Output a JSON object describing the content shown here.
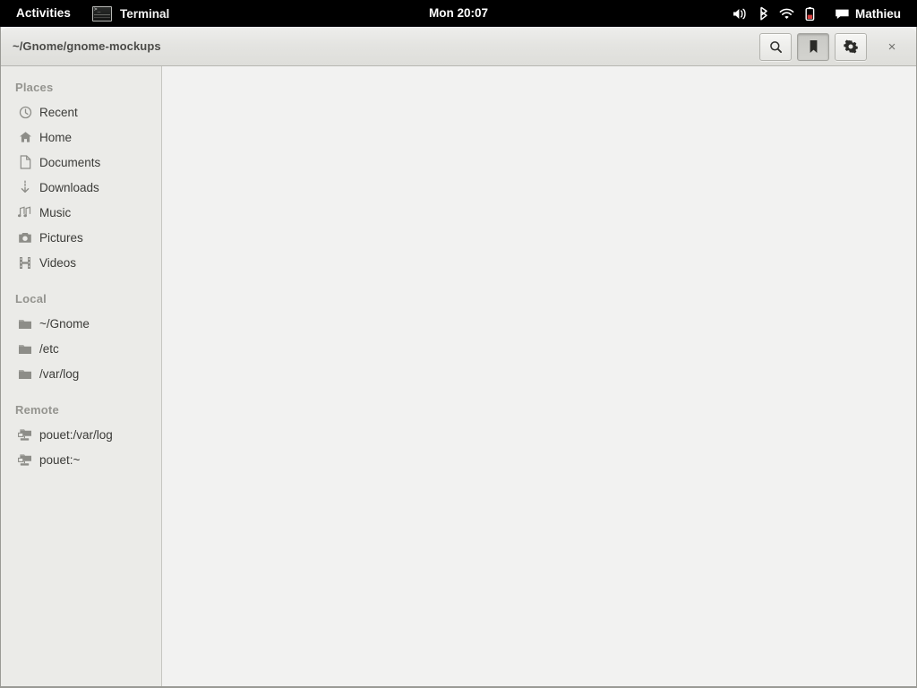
{
  "topbar": {
    "activities_label": "Activities",
    "app": {
      "name": "Terminal",
      "icon": "terminal-icon"
    },
    "clock": "Mon 20:07",
    "tray_icons": [
      "volume-icon",
      "bluetooth-icon",
      "wifi-icon",
      "battery-icon"
    ],
    "user": {
      "name": "Mathieu",
      "icon": "chat-bubble-icon"
    },
    "bg_color": "#000000",
    "fg_color": "#ffffff"
  },
  "window": {
    "title": "~/Gnome/gnome-mockups",
    "header_buttons": [
      {
        "name": "search-button",
        "icon": "search-icon",
        "label": "",
        "active": false
      },
      {
        "name": "bookmarks-button",
        "icon": "bookmark-icon",
        "label": "",
        "active": true
      },
      {
        "name": "settings-button",
        "icon": "gear-icon",
        "label": "",
        "active": false
      }
    ],
    "close_label": "×",
    "titlebar_color": "#e4e4e1",
    "content_color": "#f2f2f1"
  },
  "sidebar": {
    "bg_color": "#ebebe8",
    "sections": [
      {
        "header": "Places",
        "items": [
          {
            "label": "Recent",
            "icon": "clock-icon"
          },
          {
            "label": "Home",
            "icon": "home-icon"
          },
          {
            "label": "Documents",
            "icon": "document-icon"
          },
          {
            "label": "Downloads",
            "icon": "download-icon"
          },
          {
            "label": "Music",
            "icon": "music-note-icon"
          },
          {
            "label": "Pictures",
            "icon": "camera-icon"
          },
          {
            "label": "Videos",
            "icon": "film-strip-icon"
          }
        ]
      },
      {
        "header": "Local",
        "items": [
          {
            "label": "~/Gnome",
            "icon": "folder-icon"
          },
          {
            "label": "/etc",
            "icon": "folder-icon"
          },
          {
            "label": "/var/log",
            "icon": "folder-icon"
          }
        ]
      },
      {
        "header": "Remote",
        "items": [
          {
            "label": "pouet:/var/log",
            "icon": "remote-folder-icon"
          },
          {
            "label": "pouet:~",
            "icon": "remote-folder-icon"
          }
        ]
      }
    ]
  },
  "content": {
    "items": []
  }
}
